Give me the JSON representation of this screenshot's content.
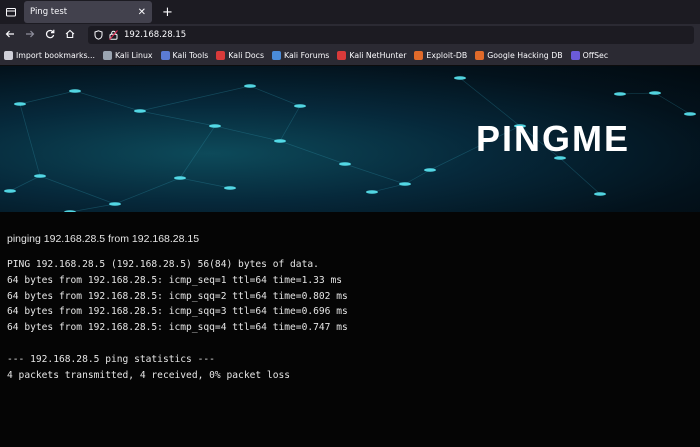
{
  "browser": {
    "tab_title": "Ping test",
    "tab_close": "✕",
    "new_tab": "+",
    "url": "192.168.28.15",
    "bookmarks": [
      {
        "label": "Import bookmarks...",
        "icon": "import-icon",
        "color": "#cfcfd8"
      },
      {
        "label": "Kali Linux",
        "icon": "kali-dragon-icon",
        "color": "#9aa4b1"
      },
      {
        "label": "Kali Tools",
        "icon": "kali-tools-icon",
        "color": "#5b7bd5"
      },
      {
        "label": "Kali Docs",
        "icon": "kali-docs-icon",
        "color": "#d83a3a"
      },
      {
        "label": "Kali Forums",
        "icon": "kali-forums-icon",
        "color": "#4a8bd8"
      },
      {
        "label": "Kali NetHunter",
        "icon": "nethunter-icon",
        "color": "#d83a3a"
      },
      {
        "label": "Exploit-DB",
        "icon": "exploit-db-icon",
        "color": "#e06a2a"
      },
      {
        "label": "Google Hacking DB",
        "icon": "ghdb-icon",
        "color": "#e06a2a"
      },
      {
        "label": "OffSec",
        "icon": "offsec-icon",
        "color": "#6b5bd8"
      }
    ]
  },
  "hero": {
    "title": "PINGME"
  },
  "ping": {
    "header": "pinging 192.168.28.5 from 192.168.28.15",
    "lines": [
      "PING 192.168.28.5 (192.168.28.5) 56(84) bytes of data.",
      "64 bytes from 192.168.28.5: icmp_seq=1 ttl=64 time=1.33 ms",
      "64 bytes from 192.168.28.5: icmp_sqq=2 ttl=64 time=0.802 ms",
      "64 bytes from 192.168.28.5: icmp_sqq=3 ttl=64 time=0.696 ms",
      "64 bytes from 192.168.28.5: icmp_sqq=4 ttl=64 time=0.747 ms",
      "",
      "--- 192.168.28.5 ping statistics ---",
      "4 packets transmitted, 4 received, 0% packet loss"
    ]
  }
}
